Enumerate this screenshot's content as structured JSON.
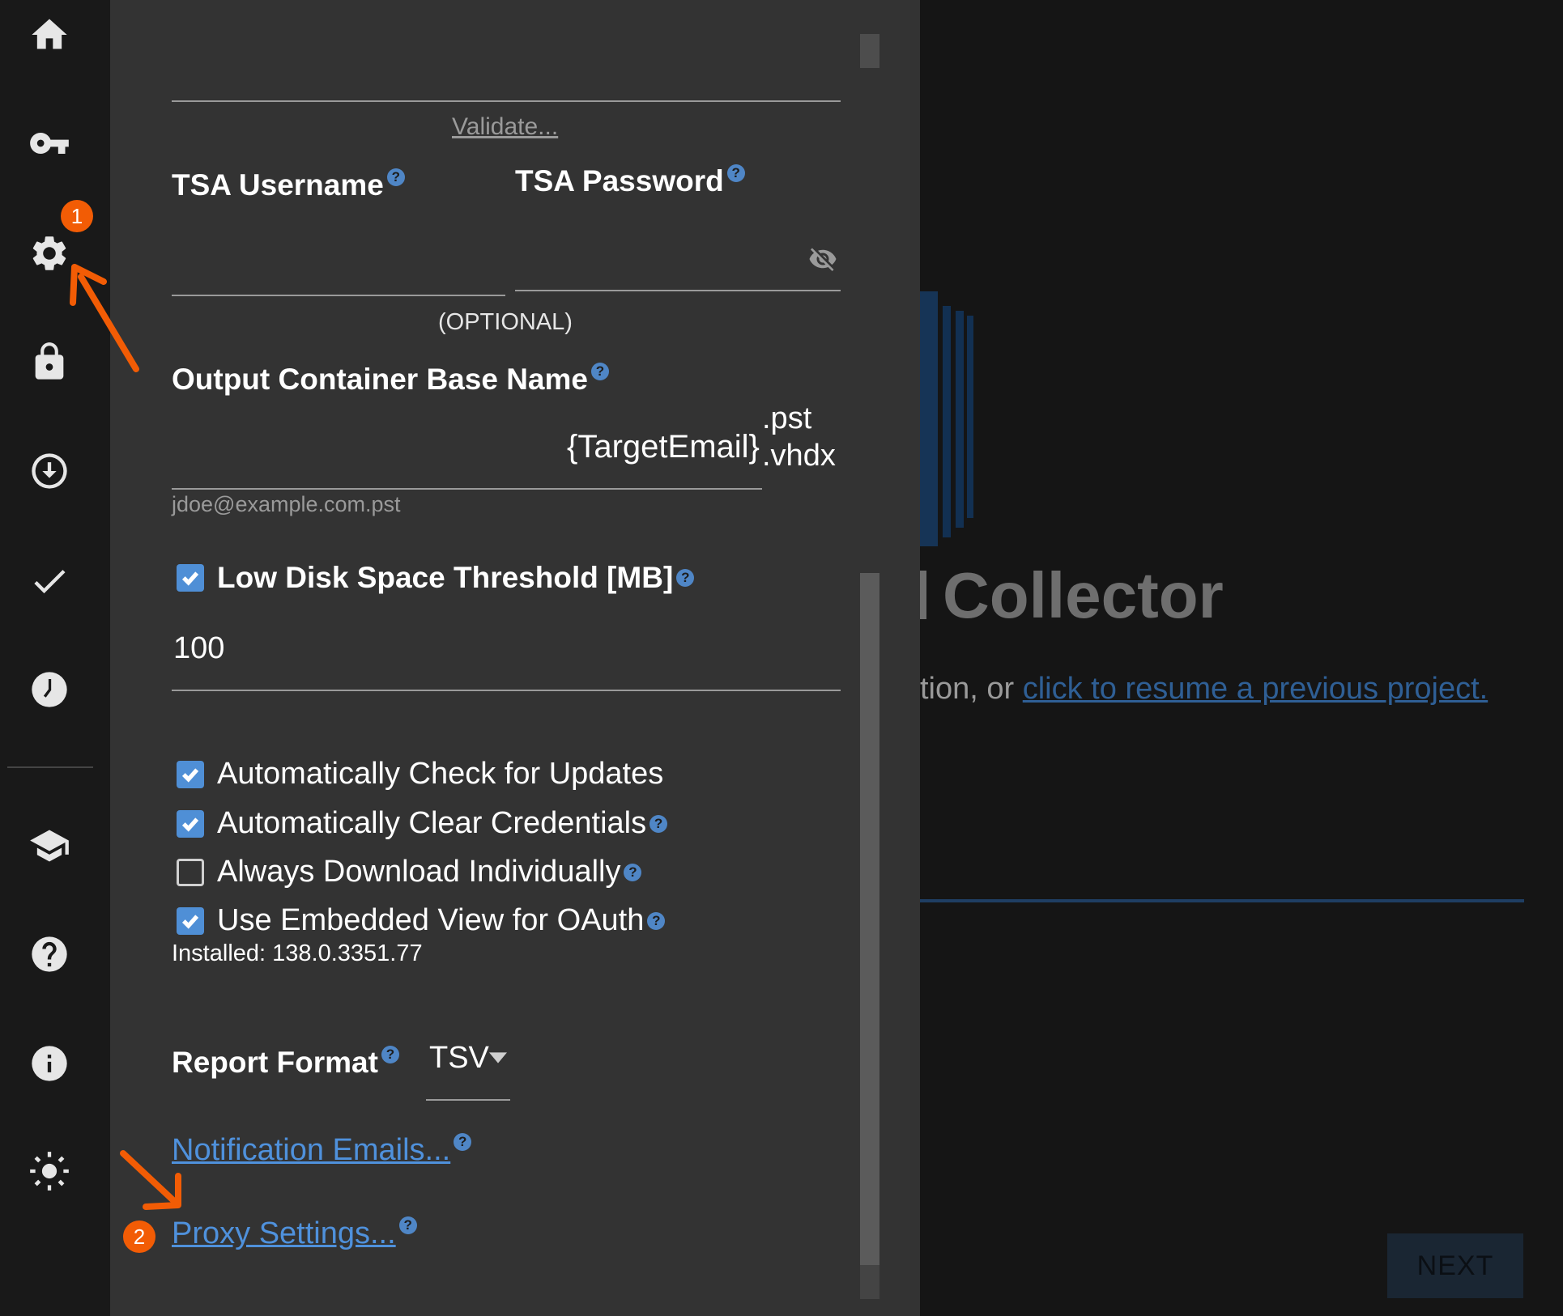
{
  "rail": {
    "items": [
      "home",
      "keys",
      "settings",
      "security",
      "download",
      "verify",
      "history",
      "training",
      "help",
      "about",
      "theme"
    ]
  },
  "panel": {
    "validate_link": "Validate...",
    "tsa_username_label": "TSA Username",
    "tsa_password_label": "TSA Password",
    "optional_hint": "(OPTIONAL)",
    "output_label": "Output Container Base Name",
    "output_value": "{TargetEmail}",
    "ext_pst": ".pst",
    "ext_vhdx": ".vhdx",
    "output_example": "jdoe@example.com.pst",
    "low_disk_label": "Low Disk Space Threshold [MB]",
    "low_disk_checked": true,
    "low_disk_value": "100",
    "options": [
      {
        "label": "Automatically Check for Updates",
        "checked": true,
        "help": false
      },
      {
        "label": "Automatically Clear Credentials",
        "checked": true,
        "help": true
      },
      {
        "label": "Always Download Individually",
        "checked": false,
        "help": true
      },
      {
        "label": "Use Embedded View for OAuth",
        "checked": true,
        "help": true
      }
    ],
    "installed_text": "Installed: 138.0.3351.77",
    "report_format_label": "Report Format",
    "report_format_value": "TSV",
    "notification_link": "Notification Emails...",
    "proxy_link": "Proxy Settings...",
    "help_glyph": "?"
  },
  "background": {
    "title": "Collector",
    "subtitle_prefix": "tion, or ",
    "resume_link": "click to resume a previous project.",
    "next_button": "NEXT"
  },
  "annotations": {
    "badge1": "1",
    "badge2": "2",
    "color": "#f25c05"
  }
}
